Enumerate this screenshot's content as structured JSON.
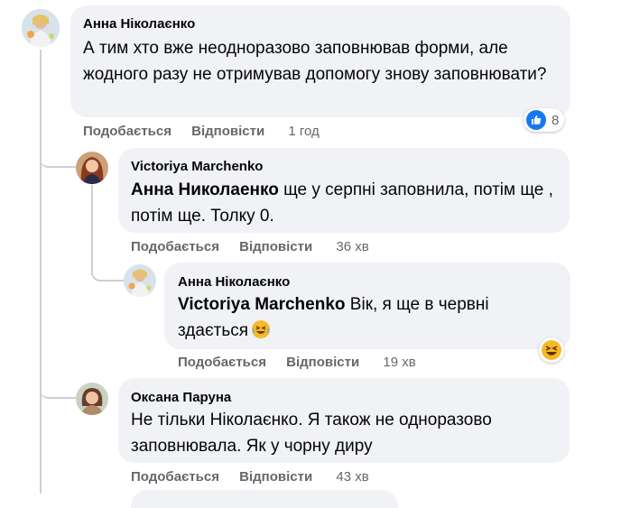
{
  "comments": [
    {
      "author": "Анна Ніколаєнко",
      "text": "А тим хто вже неодноразово заповнював форми, але жодного разу не отримував допомогу знову заповнювати?",
      "like_label": "Подобається",
      "reply_label": "Відповісти",
      "time": "1 год",
      "reaction_count": "8"
    },
    {
      "author": "Victoriya Marchenko",
      "mention": "Анна Николаенко",
      "text": " ще у серпні заповнила, потім ще , потім ще. Толку 0.",
      "like_label": "Подобається",
      "reply_label": "Відповісти",
      "time": "36 хв"
    },
    {
      "author": "Анна Ніколаєнко",
      "mention": "Victoriya Marchenko",
      "text": " Вік, я ще в червні здається",
      "like_label": "Подобається",
      "reply_label": "Відповісти",
      "time": "19 хв"
    },
    {
      "author": "Оксана Паруна",
      "text": "Не тільки Ніколаєнко. Я також не одноразово заповнювала. Як у чорну диру",
      "like_label": "Подобається",
      "reply_label": "Відповісти",
      "time": "43 хв"
    }
  ],
  "icons": {
    "like_reaction": "like-icon",
    "haha_reaction": "haha-icon",
    "inline_emoji": "laughing-face-emoji"
  },
  "colors": {
    "bubble": "#f0f2f5",
    "meta": "#65676b",
    "like_blue": "#1877f2",
    "haha_yellow": "#f7b928"
  }
}
